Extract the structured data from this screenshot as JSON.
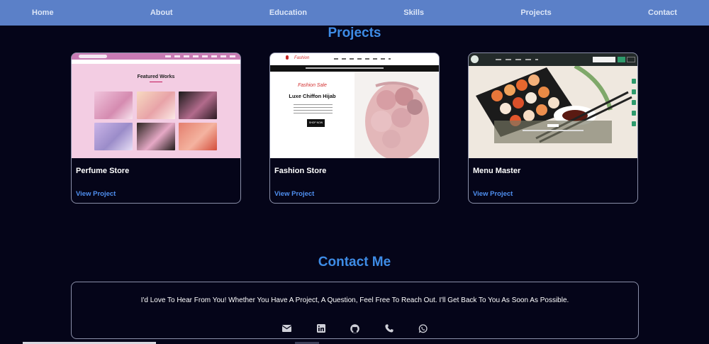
{
  "nav": {
    "items": [
      {
        "label": "Home"
      },
      {
        "label": "About"
      },
      {
        "label": "Education"
      },
      {
        "label": "Skills"
      },
      {
        "label": "Projects"
      },
      {
        "label": "Contact"
      }
    ]
  },
  "projects": {
    "title": "Projects",
    "cards": [
      {
        "name": "Perfume Store",
        "link": "View Project",
        "thumb": {
          "heading": "Featured Works"
        }
      },
      {
        "name": "Fashion Store",
        "link": "View Project",
        "thumb": {
          "sale": "Fashion Sale",
          "product": "Luxe Chiffon Hijab",
          "button": "SHOP NOW",
          "logo": "Fashion"
        }
      },
      {
        "name": "Menu Master",
        "link": "View Project",
        "thumb": {}
      }
    ]
  },
  "contact": {
    "title": "Contact Me",
    "message": "I'd Love To Hear From You! Whether You Have A Project, A Question, Feel Free To Reach Out. I'll Get Back To You As Soon As Possible.",
    "icons": [
      "envelope-icon",
      "linkedin-icon",
      "github-icon",
      "phone-icon",
      "whatsapp-icon"
    ]
  },
  "colors": {
    "background": "#050519",
    "nav": "#5b80c8",
    "accent": "#3e8ce6",
    "link": "#4f8ff0"
  }
}
